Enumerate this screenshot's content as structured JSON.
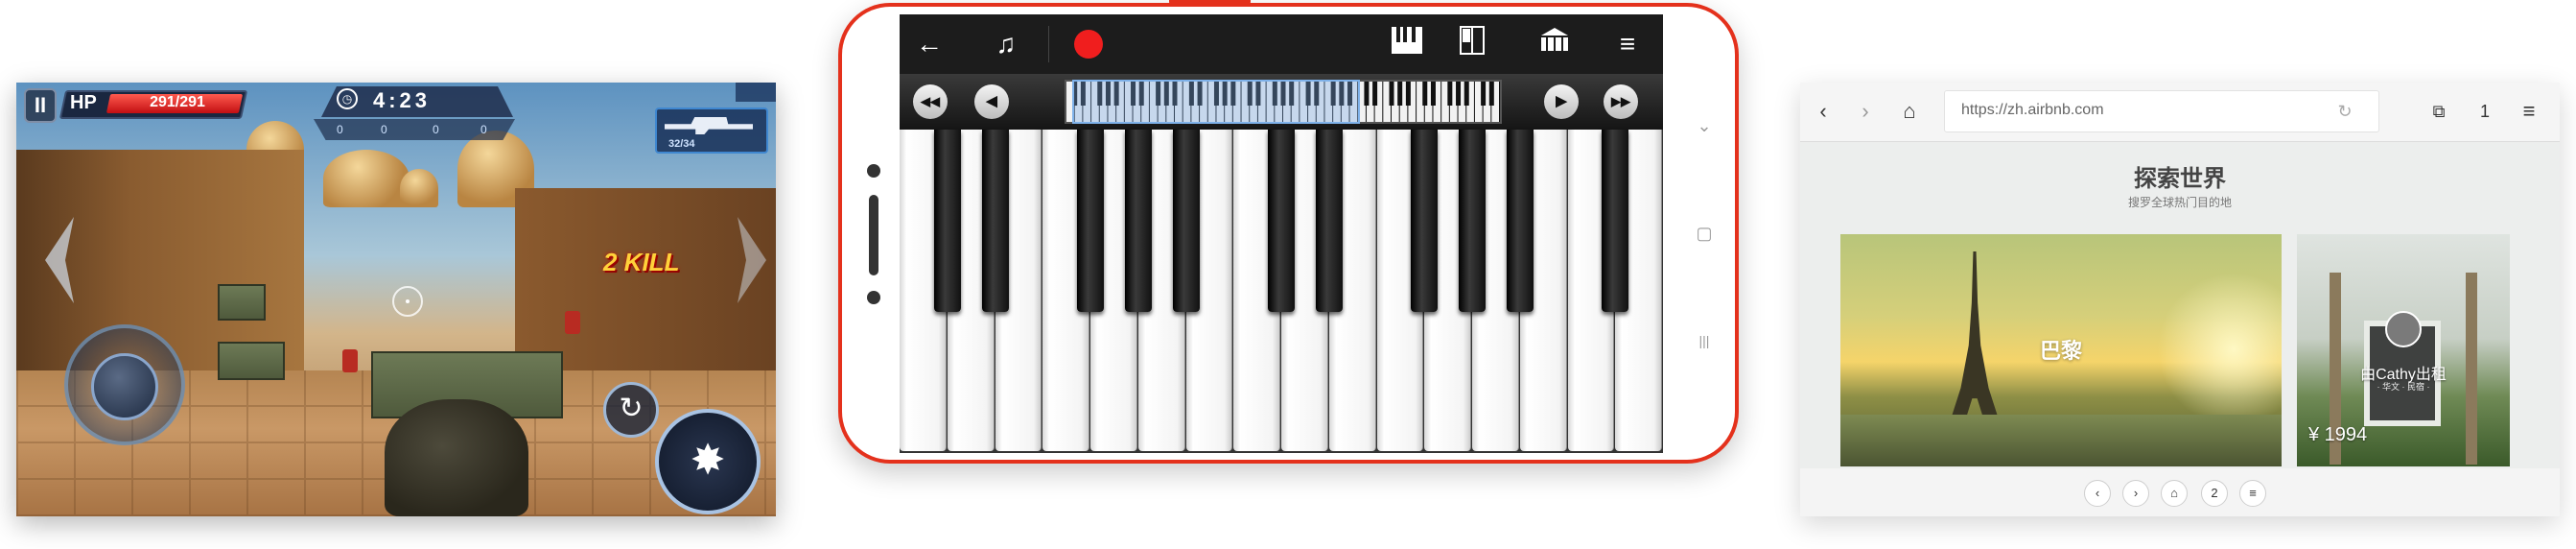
{
  "game": {
    "hp_label": "HP",
    "hp_value": "291/291",
    "timer": "4:23",
    "team_counts": [
      "0",
      "0",
      "0",
      "0"
    ],
    "ammo": "32/34",
    "kill_text": "2 KILL",
    "pause_icon": "pause-icon",
    "reload_icon": "reload-icon",
    "fire_icon": "fire-icon"
  },
  "piano": {
    "toolbar": {
      "back_icon": "←",
      "metronome_icon": "♫",
      "record_color": "#f01e1e",
      "piano_icon": "𝄃",
      "keys_icon": "▯",
      "house_icon": "⌂",
      "menu_icon": "≡"
    },
    "nav": {
      "rewind_far": "◀◀",
      "rewind": "◀",
      "forward": "▶",
      "forward_far": "▶▶"
    },
    "white_key_count": 16,
    "side_nav": [
      "⌄",
      "▢",
      "|||"
    ]
  },
  "browser": {
    "nav_back": "‹",
    "nav_forward": "›",
    "home_icon": "⌂",
    "url": "https://zh.airbnb.com",
    "refresh_icon": "↻",
    "tabs_icon": "⧉",
    "tab_count": "1",
    "menu_icon": "≡",
    "heading": "探索世界",
    "subheading": "搜罗全球热门目的地",
    "card1_label": "巴黎",
    "host_label": "由Cathy出租",
    "host_sub": "· 华文 · 民宿 ·",
    "price": "¥ 1994",
    "bottom": [
      "‹",
      "›",
      "⌂",
      "2",
      "≡"
    ]
  }
}
